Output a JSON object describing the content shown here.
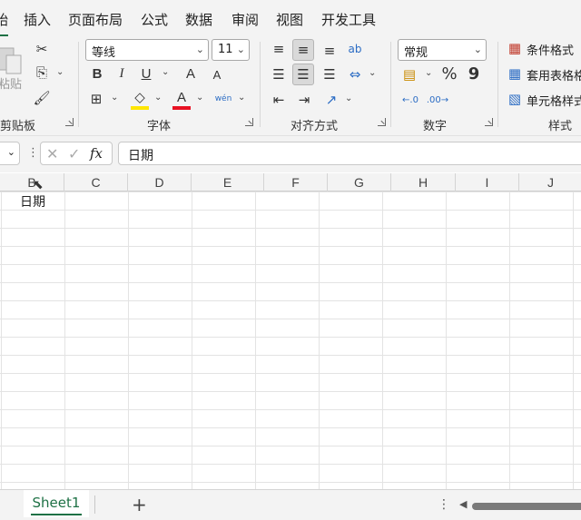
{
  "tabs": [
    "始",
    "插入",
    "页面布局",
    "公式",
    "数据",
    "审阅",
    "视图",
    "开发工具"
  ],
  "ribbon": {
    "clipboard": {
      "paste_label": "粘贴",
      "group_label": "剪贴板"
    },
    "font": {
      "name": "等线",
      "size": "11",
      "group_label": "字体",
      "bold": "B",
      "italic": "I",
      "underline": "U",
      "grow": "A",
      "shrink": "A",
      "pinyin": "wén"
    },
    "alignment": {
      "group_label": "对齐方式"
    },
    "number": {
      "format": "常规",
      "percent": "%",
      "comma": "9",
      "group_label": "数字"
    },
    "styles": {
      "conditional": "条件格式",
      "table": "套用表格格",
      "cell": "单元格样式",
      "group_label": "样式"
    }
  },
  "formula_bar": {
    "fx": "fx",
    "value": "日期"
  },
  "columns": [
    "B",
    "C",
    "D",
    "E",
    "F",
    "G",
    "H",
    "I",
    "J"
  ],
  "cells": {
    "B1": "日期"
  },
  "sheets": {
    "active": "Sheet1",
    "add": "+"
  },
  "colors": {
    "accent": "#1e7145",
    "highlight": "#ffe600",
    "font_red": "#e81123"
  }
}
